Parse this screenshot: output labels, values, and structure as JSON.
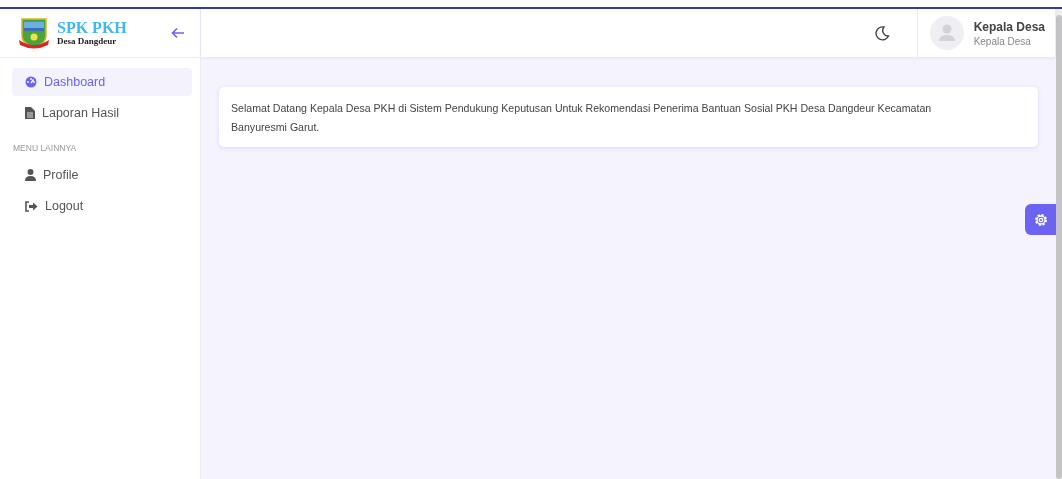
{
  "brand": {
    "title": "SPK PKH",
    "subtitle": "Desa Dangdeur"
  },
  "sidebar": {
    "items": [
      {
        "label": "Dashboard",
        "kind": "dashboard",
        "selected": true
      },
      {
        "label": "Laporan Hasil",
        "kind": "report",
        "selected": false
      }
    ],
    "section": "MENU LAINNYA",
    "more_items": [
      {
        "label": "Profile",
        "kind": "profile",
        "selected": false
      },
      {
        "label": "Logout",
        "kind": "logout",
        "selected": false
      }
    ]
  },
  "user": {
    "name": "Kepala Desa",
    "role": "Kepala Desa"
  },
  "welcome": "Selamat Datang Kepala Desa PKH di Sistem Pendukung Keputusan Untuk Rekomendasi Penerima Bantuan Sosial PKH Desa Dangdeur Kecamatan Banyuresmi Garut."
}
